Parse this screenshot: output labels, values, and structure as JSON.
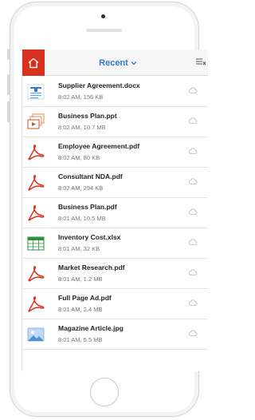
{
  "header": {
    "title": "Recent",
    "accent_color": "#2e7ad1",
    "home_color": "#d8311e",
    "home_icon": "home-icon",
    "sort_icon": "sort-icon"
  },
  "files": [
    {
      "name": "Supplier Agreement.docx",
      "meta": "8:02 AM, 156 KB",
      "type": "docx"
    },
    {
      "name": "Business Plan.ppt",
      "meta": "8:02 AM, 10.7 MB",
      "type": "ppt"
    },
    {
      "name": "Employee Agreement.pdf",
      "meta": "8:02 AM, 80 KB",
      "type": "pdf"
    },
    {
      "name": "Consultant NDA.pdf",
      "meta": "8:02 AM, 294 KB",
      "type": "pdf"
    },
    {
      "name": "Business Plan.pdf",
      "meta": "8:01 AM, 10.5 MB",
      "type": "pdf"
    },
    {
      "name": "Inventory Cost.xlsx",
      "meta": "8:01 AM, 32 KB",
      "type": "xlsx"
    },
    {
      "name": "Market Research.pdf",
      "meta": "8:01 AM, 1.2 MB",
      "type": "pdf"
    },
    {
      "name": "Full Page Ad.pdf",
      "meta": "8:01 AM, 2.4 MB",
      "type": "pdf"
    },
    {
      "name": "Magazine Article.jpg",
      "meta": "8:01 AM, 5.5 MB",
      "type": "jpg"
    }
  ]
}
